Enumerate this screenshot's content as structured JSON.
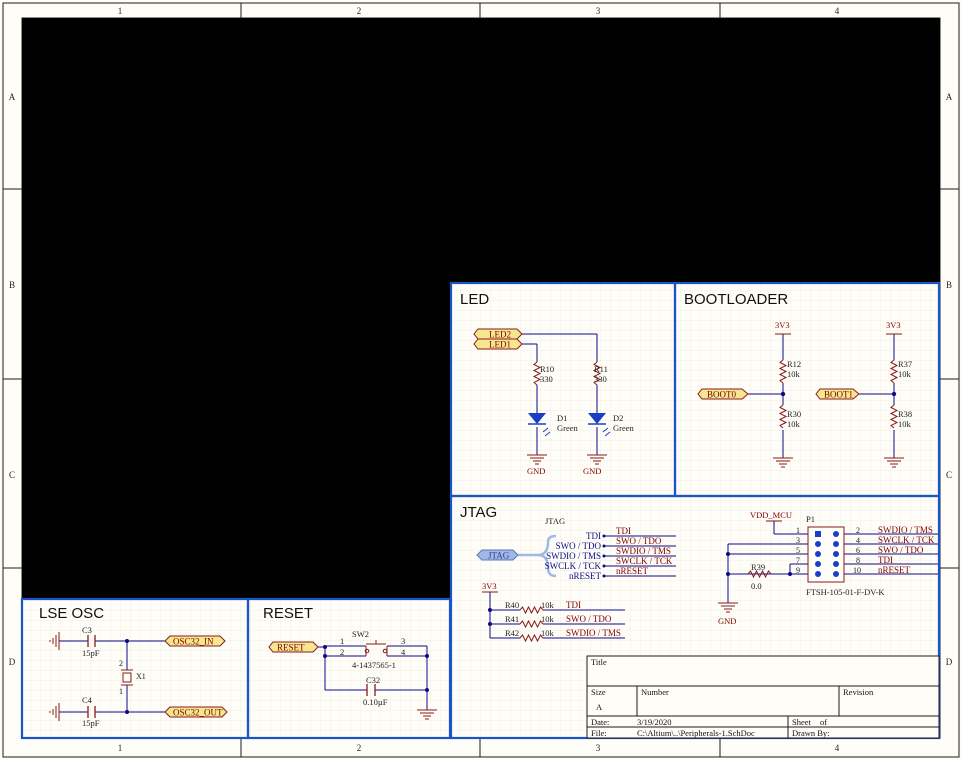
{
  "frame": {
    "cols": [
      "1",
      "2",
      "3",
      "4"
    ],
    "rows": [
      "A",
      "B",
      "C",
      "D"
    ]
  },
  "led": {
    "title": "LED",
    "ports": [
      "LED2",
      "LED1"
    ],
    "r10": {
      "ref": "R10",
      "value": "330"
    },
    "r11": {
      "ref": "R11",
      "value": "330"
    },
    "d1": {
      "ref": "D1",
      "value": "Green"
    },
    "d2": {
      "ref": "D2",
      "value": "Green"
    },
    "gnd": "GND"
  },
  "bootloader": {
    "title": "BOOTLOADER",
    "power": "3V3",
    "boot0": {
      "port": "BOOT0",
      "r_top": {
        "ref": "R12",
        "value": "10k"
      },
      "r_bot": {
        "ref": "R30",
        "value": "10k"
      }
    },
    "boot1": {
      "port": "BOOT1",
      "r_top": {
        "ref": "R37",
        "value": "10k"
      },
      "r_bot": {
        "ref": "R38",
        "value": "10k"
      }
    }
  },
  "jtag": {
    "title": "JTAG",
    "harness_label": "JTAG",
    "port": "JTAG",
    "entries": [
      "TDI",
      "SWO / TDO",
      "SWDIO / TMS",
      "SWCLK / TCK",
      "nRESET"
    ],
    "nets": [
      "TDI",
      "SWO / TDO",
      "SWDIO / TMS",
      "SWCLK / TCK",
      "nRESET"
    ],
    "power": "3V3",
    "pullups": [
      {
        "ref": "R40",
        "value": "10k",
        "net": "TDI"
      },
      {
        "ref": "R41",
        "value": "10k",
        "net": "SWO / TDO"
      },
      {
        "ref": "R42",
        "value": "10k",
        "net": "SWDIO / TMS"
      }
    ],
    "vdd": "VDD_MCU",
    "connector": {
      "ref": "P1",
      "part": "FTSH-105-01-F-DV-K",
      "left_pins": [
        "1",
        "3",
        "5",
        "7",
        "9"
      ],
      "right_pins": [
        "2",
        "4",
        "6",
        "8",
        "10"
      ],
      "right_nets": [
        "SWDIO / TMS",
        "SWCLK / TCK",
        "SWO / TDO",
        "TDI",
        "nRESET"
      ]
    },
    "r39": {
      "ref": "R39",
      "value": "0.0"
    },
    "gnd": "GND"
  },
  "lse": {
    "title": "LSE OSC",
    "c3": {
      "ref": "C3",
      "value": "15pF"
    },
    "c4": {
      "ref": "C4",
      "value": "15pF"
    },
    "x1": {
      "ref": "X1",
      "pin1": "1",
      "pin2": "2"
    },
    "ports": [
      "OSC32_IN",
      "OSC32_OUT"
    ]
  },
  "reset": {
    "title": "RESET",
    "port": "RESET",
    "sw": {
      "ref": "SW2",
      "part": "4-1437565-1",
      "pins": [
        "1",
        "2",
        "3",
        "4"
      ]
    },
    "c32": {
      "ref": "C32",
      "value": "0.10µF"
    }
  },
  "title_block": {
    "title_label": "Title",
    "size_label": "Size",
    "size_value": "A",
    "number_label": "Number",
    "revision_label": "Revision",
    "date_label": "Date:",
    "date_value": "3/19/2020",
    "sheet_label": "Sheet",
    "of_label": "of",
    "file_label": "File:",
    "file_value": "C:\\Altium\\..\\Peripherals-1.SchDoc",
    "drawn_label": "Drawn By:"
  },
  "colors": {
    "sheet": "#fffdf7",
    "grid": "#e8e4d8",
    "border": "#1c1c1c",
    "box": "#1a55c8",
    "wire": "#0b0b8a",
    "component": "#8a1a1a",
    "net": "#800000",
    "port_fill": "#f5e690",
    "harness": "#9fb8e6",
    "diode": "#1a3ec8"
  }
}
